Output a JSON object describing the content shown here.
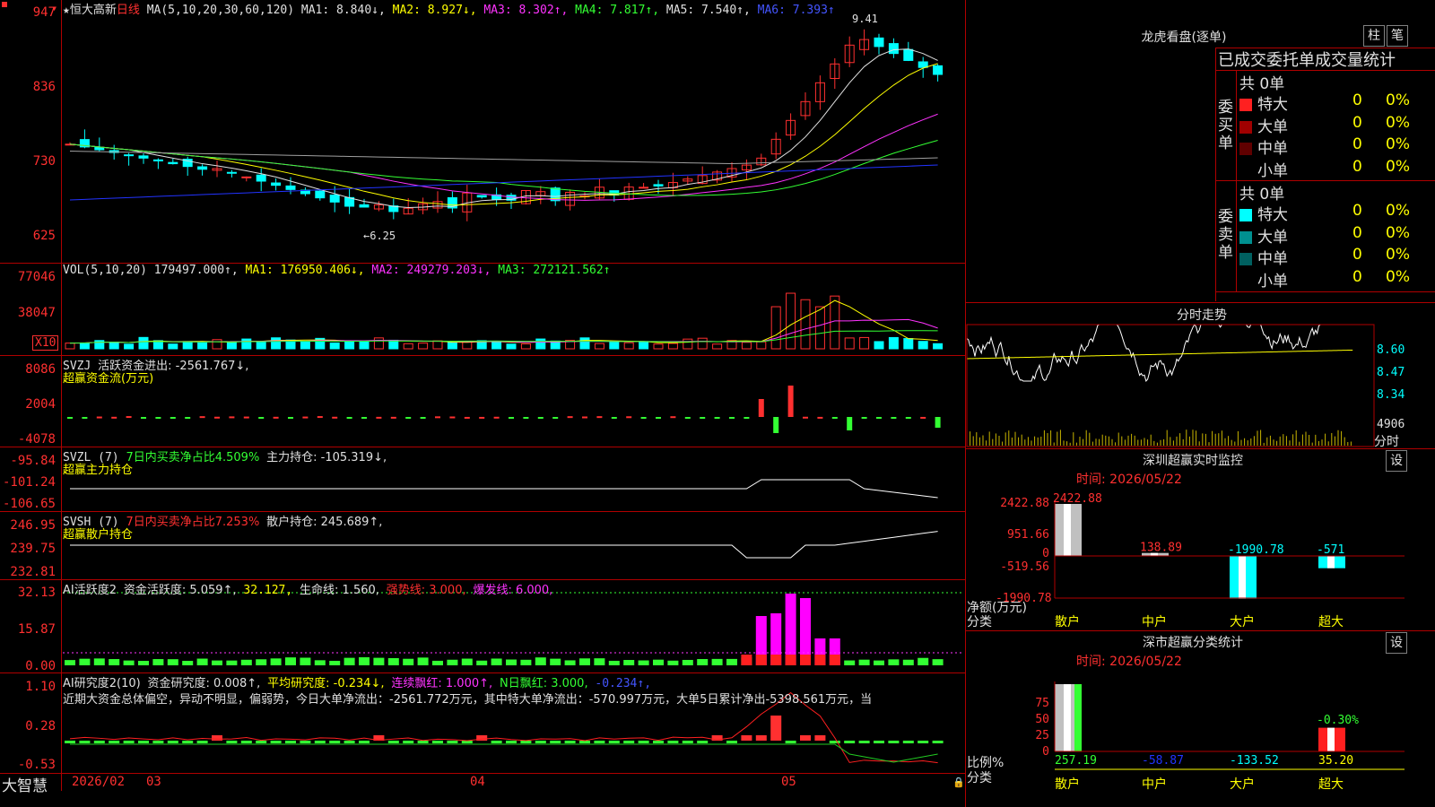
{
  "colors": {
    "up": "#ff3030",
    "down": "#00ffff",
    "ma1": "#e0e0e0",
    "ma2": "#ffff00",
    "ma3": "#ff33ff",
    "ma4": "#33ff33",
    "ma5": "#a0a0a0",
    "ma6": "#2233ff",
    "grid": "#b00000"
  },
  "main": {
    "stock_name": "恒大高新",
    "period": "日线",
    "ma_label": "MA(5,10,20,30,60,120)",
    "ma1": "MA1: 8.840↓,",
    "ma2": "MA2: 8.927↓,",
    "ma3": "MA3: 8.302↑,",
    "ma4": "MA4: 7.817↑,",
    "ma5": "MA5: 7.540↑,",
    "ma6": "MA6: 7.393↑",
    "yticks": [
      "947",
      "836",
      "730",
      "625"
    ],
    "high_note": "9.41",
    "low_note": "←6.25"
  },
  "vol": {
    "label": "VOL(5,10,20)",
    "val": "179497.000↑,",
    "ma1": "MA1: 176950.406↓,",
    "ma2": "MA2: 249279.203↓,",
    "ma3": "MA3: 272121.562↑",
    "yticks": [
      "77046",
      "38047"
    ],
    "unit": "X10"
  },
  "svzj": {
    "label": "SVZJ",
    "text": "活跃资金进出: -2561.767↓,",
    "sub": "超赢资金流(万元)",
    "yticks": [
      "8086",
      "2004",
      "-4078"
    ]
  },
  "svzl": {
    "label": "SVZL (7)",
    "text1": "7日内买卖净占比4.509%",
    "text2": "主力持仓: -105.319↓,",
    "sub": "超赢主力持仓",
    "yticks": [
      "-95.84",
      "-101.24",
      "-106.65"
    ]
  },
  "svsh": {
    "label": "SVSH (7)",
    "text1": "7日内买卖净占比7.253%",
    "text2": "散户持仓: 245.689↑,",
    "sub": "超赢散户持仓",
    "yticks": [
      "246.95",
      "239.75",
      "232.81"
    ]
  },
  "ai2": {
    "label": "AI活跃度2",
    "t1": "资金活跃度: 5.059↑,",
    "t2": "32.127,",
    "t3": "生命线: 1.560,",
    "t4": "强势线: 3.000,",
    "t5": "爆发线: 6.000,",
    "yticks": [
      "32.13",
      "15.87",
      "0.00"
    ]
  },
  "ai_research": {
    "label": "AI研究度2(10)",
    "t1": "资金研究度: 0.008↑,",
    "t2": "平均研究度: -0.234↓,",
    "t3": "连续飘红: 1.000↑,",
    "t4": "N日飘红: 3.000,",
    "t5": "-0.234↑,",
    "summary": "近期大资金总体偏空，异动不明显，偏弱势，今日大单净流出：-2561.772万元，其中特大单净流出：-570.997万元，大单5日累计净出-5398.561万元，当",
    "yticks": [
      "1.10",
      "0.28",
      "-0.53"
    ]
  },
  "xaxis": {
    "brand": "大智慧",
    "labels": [
      "2026/02",
      "03",
      "04",
      "05"
    ]
  },
  "lhb": {
    "title": "龙虎看盘(逐单)",
    "btn1": "柱",
    "btn2": "笔",
    "header": "已成交委托单成交量统计",
    "buy_side": "委买单",
    "sell_side": "委卖单",
    "buy_total": "共 0单",
    "sell_total": "共 0单",
    "buy_rows": [
      {
        "name": "特大",
        "n": "0",
        "p": "0%",
        "color": "#ff2020"
      },
      {
        "name": "大单",
        "n": "0",
        "p": "0%",
        "color": "#a00000"
      },
      {
        "name": "中单",
        "n": "0",
        "p": "0%",
        "color": "#600000"
      },
      {
        "name": "小单",
        "n": "0",
        "p": "0%",
        "color": "#000000"
      }
    ],
    "sell_rows": [
      {
        "name": "特大",
        "n": "0",
        "p": "0%",
        "color": "#00ffff"
      },
      {
        "name": "大单",
        "n": "0",
        "p": "0%",
        "color": "#009090"
      },
      {
        "name": "中单",
        "n": "0",
        "p": "0%",
        "color": "#006060"
      },
      {
        "name": "小单",
        "n": "0",
        "p": "0%",
        "color": "#000000"
      }
    ]
  },
  "fenshi": {
    "title": "分时走势",
    "yticks": [
      "8.60",
      "8.47",
      "8.34"
    ],
    "vol_tick": "4906",
    "unit": "分时"
  },
  "monitor": {
    "title": "深圳超赢实时监控",
    "btn": "设",
    "time": "时间: 2026/05/22",
    "yticks": [
      "2422.88",
      "951.66",
      "0",
      "-519.56",
      "-1990.78"
    ],
    "ylabel1": "净额(万元)",
    "ylabel2": "分类",
    "cats": [
      "散户",
      "中户",
      "大户",
      "超大"
    ],
    "values": [
      2422.88,
      138.89,
      -1990.78,
      -571
    ],
    "value_labels": [
      "2422.88",
      "138.89",
      "-1990.78",
      "-571"
    ]
  },
  "classify": {
    "title": "深市超赢分类统计",
    "btn": "设",
    "time": "时间: 2026/05/22",
    "yticks": [
      "75",
      "50",
      "25",
      "0"
    ],
    "ylabel1": "比例%",
    "ylabel2": "分类",
    "cats": [
      "散户",
      "中户",
      "大户",
      "超大"
    ],
    "bar_values": [
      100,
      0,
      0,
      35.2
    ],
    "value_labels": [
      "257.19",
      "-58.87",
      "-133.52",
      "35.20"
    ],
    "note": "-0.30%"
  }
}
